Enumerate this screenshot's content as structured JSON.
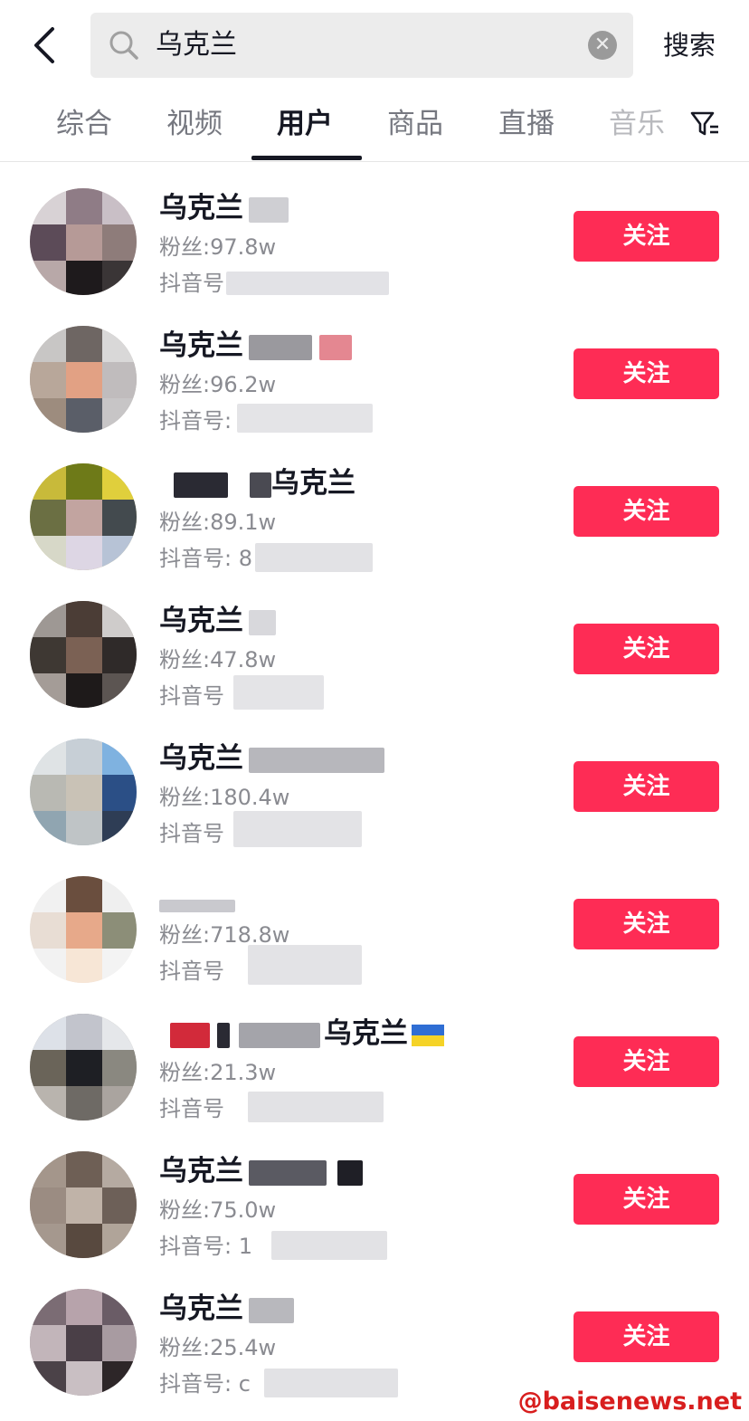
{
  "header": {
    "search_query": "乌克兰",
    "search_button": "搜索"
  },
  "tabs": [
    {
      "label": "综合"
    },
    {
      "label": "视频"
    },
    {
      "label": "用户"
    },
    {
      "label": "商品"
    },
    {
      "label": "直播"
    },
    {
      "label": "音乐"
    }
  ],
  "colors": {
    "follow_button": "#fe2c55",
    "watermark": "#d81e1e"
  },
  "results": [
    {
      "name": "乌克兰",
      "fans": "粉丝:97.8w",
      "uid_label": "抖音号: 2",
      "follow": "关注"
    },
    {
      "name": "乌克兰",
      "fans": "粉丝:96.2w",
      "uid_label": "抖音号:",
      "follow": "关注"
    },
    {
      "name": "乌克兰",
      "fans": "粉丝:89.1w",
      "uid_label": "抖音号: 8",
      "follow": "关注"
    },
    {
      "name": "乌克兰",
      "fans": "粉丝:47.8w",
      "uid_label": "抖音号",
      "follow": "关注"
    },
    {
      "name": "乌克兰",
      "fans": "粉丝:180.4w",
      "uid_label": "抖音号",
      "follow": "关注"
    },
    {
      "name": "",
      "fans": "粉丝:718.8w",
      "uid_label": "抖音号",
      "follow": "关注"
    },
    {
      "name": "乌克兰",
      "fans": "粉丝:21.3w",
      "uid_label": "抖音号",
      "follow": "关注"
    },
    {
      "name": "乌克兰",
      "fans": "粉丝:75.0w",
      "uid_label": "抖音号: 1",
      "follow": "关注"
    },
    {
      "name": "乌克兰",
      "fans": "粉丝:25.4w",
      "uid_label": "抖音号: c",
      "follow": "关注"
    }
  ],
  "watermark": "@baisenews.net"
}
